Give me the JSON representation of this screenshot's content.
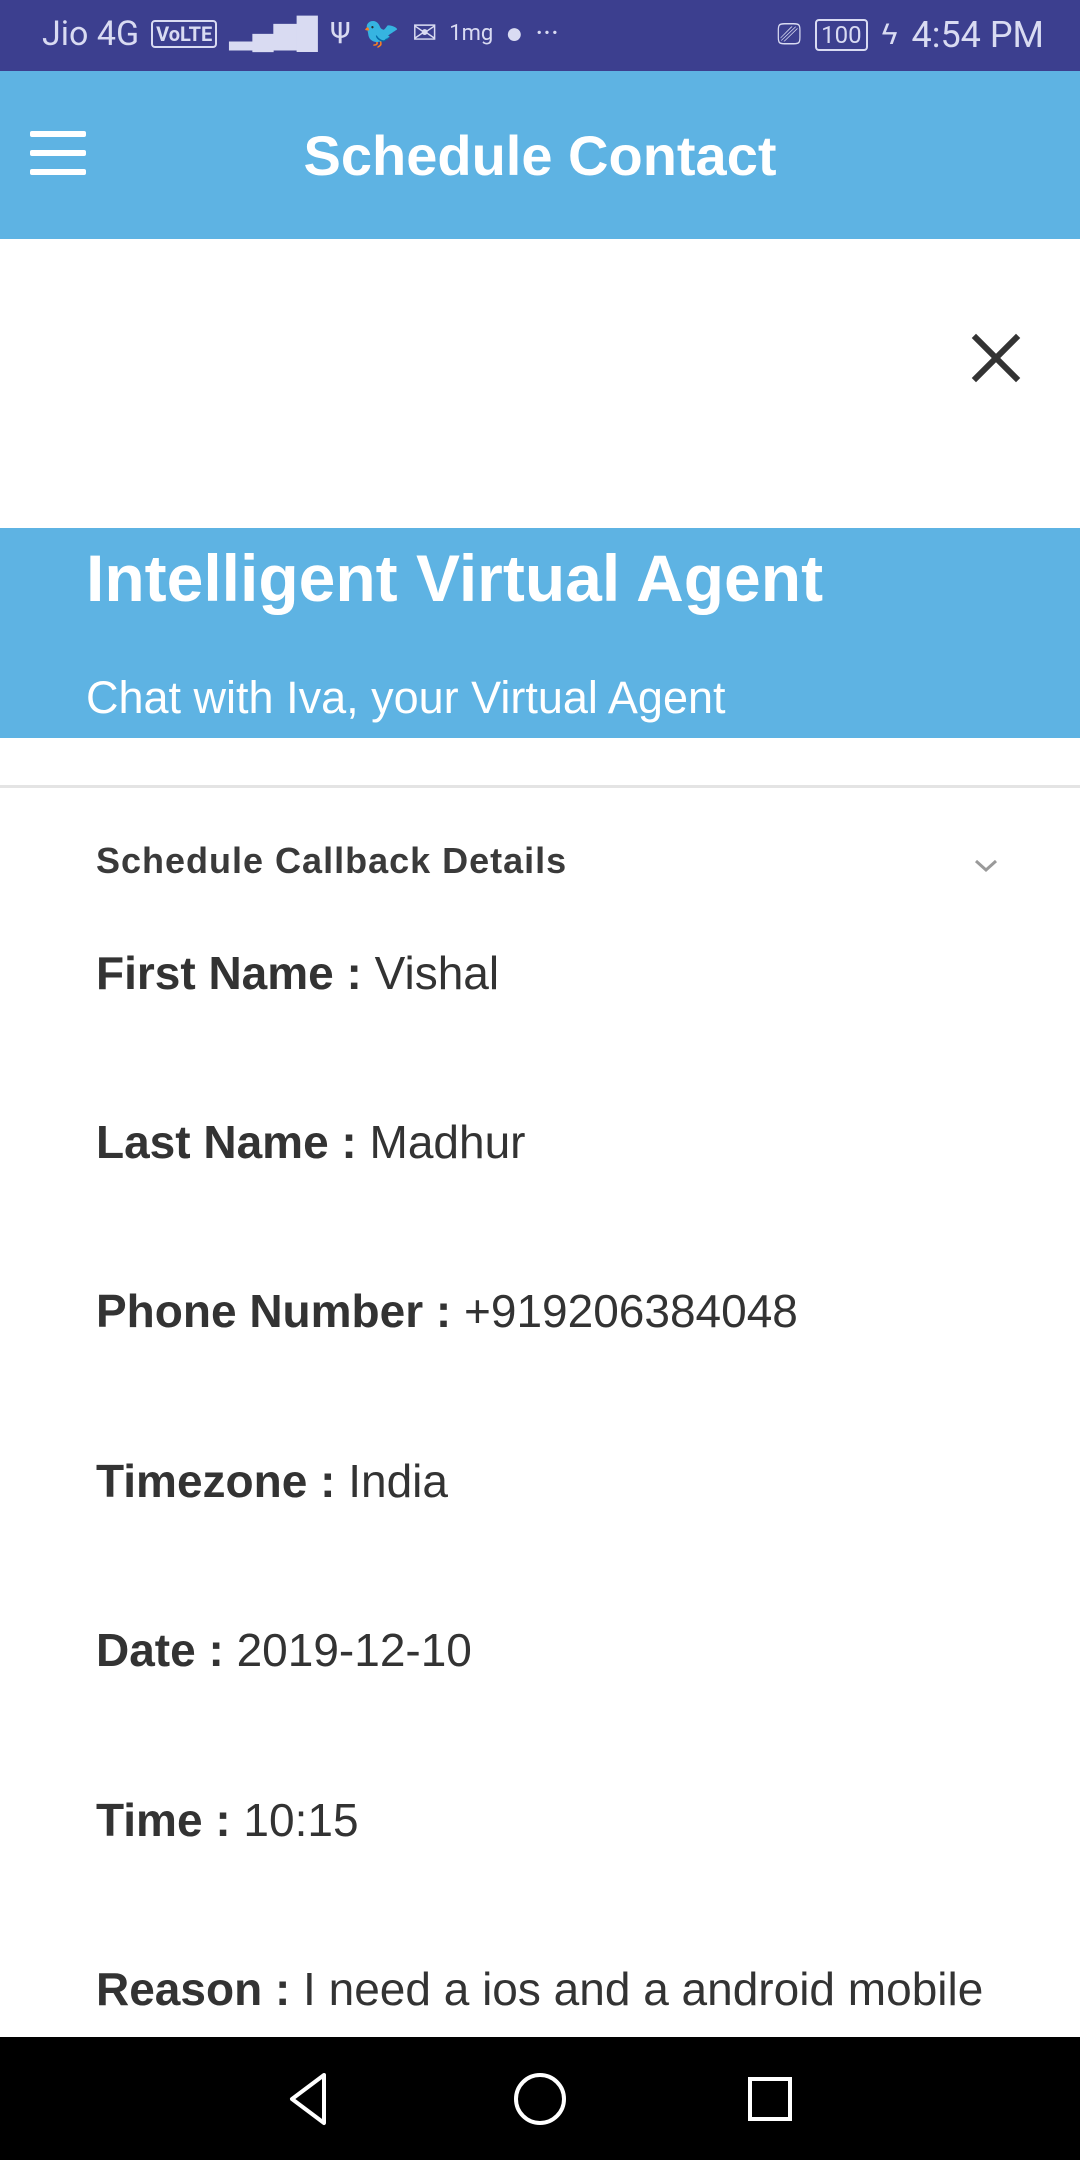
{
  "status_bar": {
    "carrier": "Jio 4G",
    "volte": "VoLTE",
    "icons_left": [
      "signal-icon",
      "usb-icon",
      "twitter-icon",
      "mail-icon",
      "1mg-icon",
      "chat-bubble-icon",
      "more-icon"
    ],
    "battery": "100",
    "time": "4:54 PM"
  },
  "app_bar": {
    "title": "Schedule Contact",
    "menu_icon": "hamburger-menu-icon",
    "color": "#5eb3e3"
  },
  "banner": {
    "title": "Intelligent Virtual Agent",
    "subtitle": "Chat with Iva, your Virtual Agent"
  },
  "details": {
    "section_title": "Schedule Callback Details",
    "fields": [
      {
        "label": "First Name :",
        "value": "Vishal"
      },
      {
        "label": "Last Name :",
        "value": "Madhur"
      },
      {
        "label": "Phone Number :",
        "value": "+919206384048"
      },
      {
        "label": "Timezone :",
        "value": "India"
      },
      {
        "label": "Date :",
        "value": "2019-12-10"
      },
      {
        "label": "Time :",
        "value": "10:15"
      },
      {
        "label": "Reason :",
        "value": "I need a ios and a android mobile"
      }
    ]
  },
  "nav_bar": {
    "buttons": [
      "back-icon",
      "home-icon",
      "recents-icon"
    ]
  }
}
